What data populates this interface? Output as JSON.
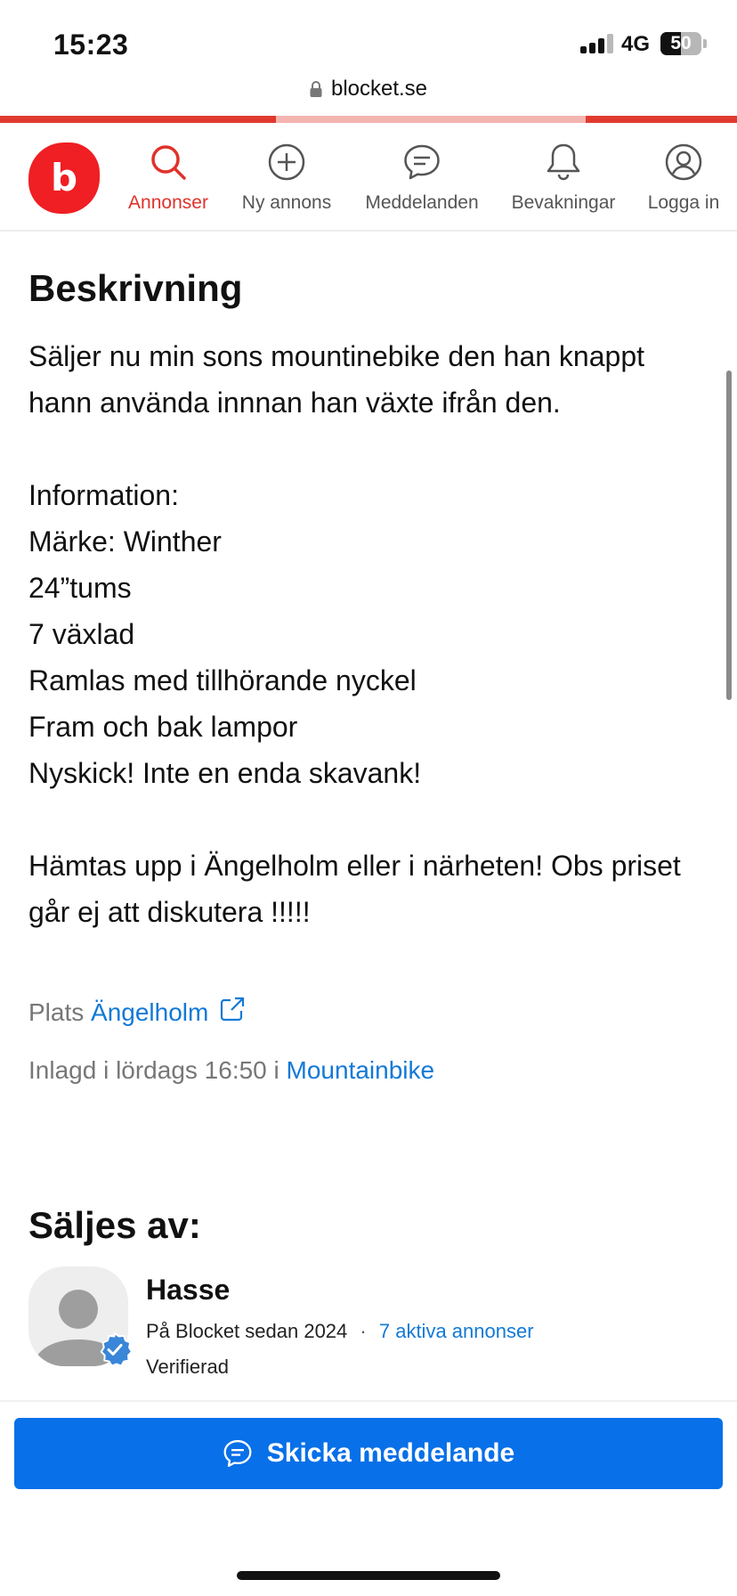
{
  "status_bar": {
    "time": "15:23",
    "network": "4G",
    "battery": "50",
    "battery_level": 0.5,
    "signal_bars": 3
  },
  "browser": {
    "url": "blocket.se"
  },
  "nav": {
    "logo_text": "b",
    "items": [
      {
        "label": "Annonser",
        "icon": "search-icon",
        "active": true
      },
      {
        "label": "Ny annons",
        "icon": "plus-circle-icon",
        "active": false
      },
      {
        "label": "Meddelanden",
        "icon": "chat-bubble-icon",
        "active": false
      },
      {
        "label": "Bevakningar",
        "icon": "bell-icon",
        "active": false
      },
      {
        "label": "Logga in",
        "icon": "user-circle-icon",
        "active": false
      }
    ]
  },
  "description": {
    "heading": "Beskrivning",
    "lines": [
      "Säljer nu min sons mountinebike den han knappt",
      "hann använda innnan han växte ifrån den.",
      "",
      "Information:",
      "Märke: Winther",
      "24”tums",
      "7 växlad",
      "Ramlas med tillhörande nyckel",
      "Fram och bak lampor",
      "Nyskick! Inte en enda skavank!",
      "",
      "Hämtas upp i Ängelholm eller i närheten! Obs priset",
      "går ej att diskutera !!!!!"
    ]
  },
  "location": {
    "label": "Plats",
    "value": "Ängelholm",
    "icon": "external-link-icon"
  },
  "posted": {
    "text": "Inlagd i lördags 16:50 i",
    "category": "Mountainbike"
  },
  "seller": {
    "heading": "Säljes av:",
    "name": "Hasse",
    "since": "På Blocket sedan 2024",
    "separator": "·",
    "active_ads": "7 aktiva annonser",
    "status": "Verifierad"
  },
  "cta": {
    "label": "Skicka meddelande",
    "icon": "chat-bubble-icon"
  },
  "colors": {
    "brand_red": "#ef1f24",
    "active_red": "#e0322a",
    "link_blue": "#1279d6",
    "cta_blue": "#0870e8"
  }
}
